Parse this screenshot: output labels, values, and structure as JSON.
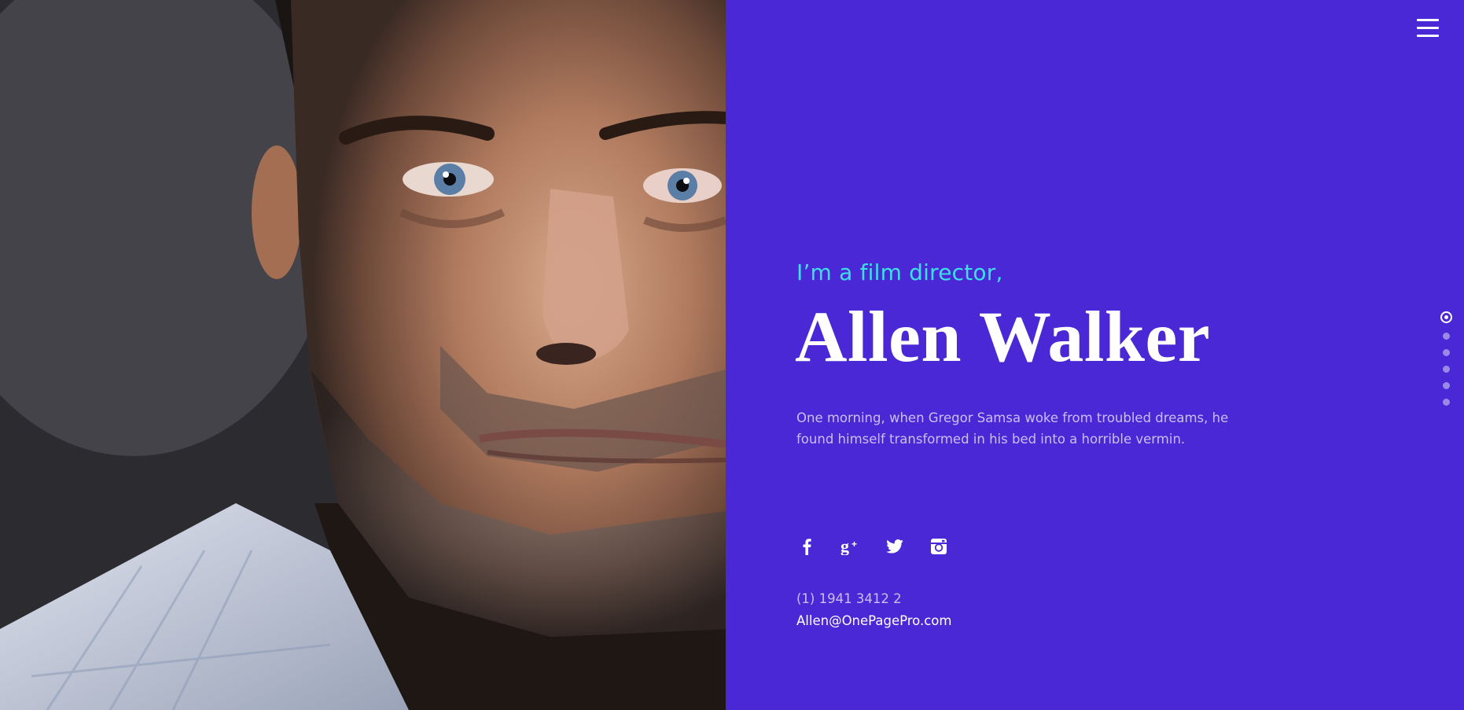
{
  "hero": {
    "tagline": "I’m a film director,",
    "name": "Allen Walker",
    "bio": "One morning, when Gregor Samsa woke from troubled dreams, he found himself transformed in his bed into a horrible vermin."
  },
  "contact": {
    "phone": "(1) 1941 3412 2",
    "email": "Allen@OnePagePro.com"
  },
  "socials": [
    {
      "icon": "facebook-icon"
    },
    {
      "icon": "google-plus-icon"
    },
    {
      "icon": "twitter-icon"
    },
    {
      "icon": "instagram-icon"
    }
  ],
  "navigation": {
    "menu_icon": "hamburger-menu-icon",
    "section_dots_count": 6,
    "active_dot_index": 0
  },
  "colors": {
    "panel_background": "#4a28d6",
    "tagline": "#3ee0e8",
    "name": "#ffffff",
    "muted_text": "#c9bff2"
  }
}
